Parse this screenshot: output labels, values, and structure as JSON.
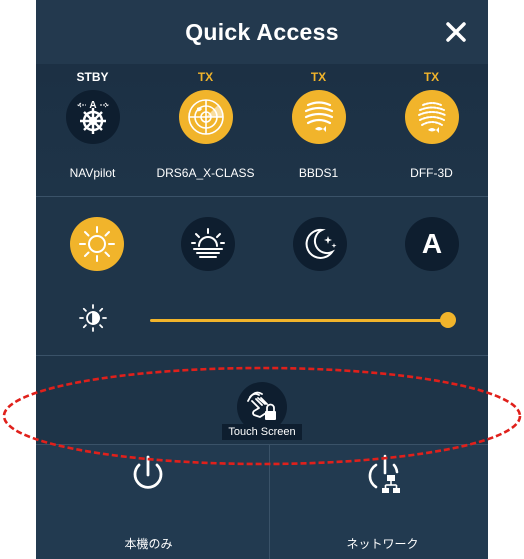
{
  "header": {
    "title": "Quick Access",
    "close_icon": "close-icon"
  },
  "devices": [
    {
      "status": "STBY",
      "name": "NAVpilot",
      "icon": "autopilot-helm-icon",
      "style": "dark"
    },
    {
      "status": "TX",
      "name": "DRS6A_X-CLASS",
      "icon": "radar-icon",
      "style": "yellow"
    },
    {
      "status": "TX",
      "name": "BBDS1",
      "icon": "sounder-fish-icon",
      "style": "yellow"
    },
    {
      "status": "TX",
      "name": "DFF-3D",
      "icon": "sounder-3d-icon",
      "style": "yellow"
    }
  ],
  "display_modes": [
    {
      "icon": "sun-day-mode-icon",
      "selected": true
    },
    {
      "icon": "sunset-dusk-mode-icon",
      "selected": false
    },
    {
      "icon": "moon-night-mode-icon",
      "selected": false
    },
    {
      "icon": "auto-mode-icon",
      "label": "A",
      "selected": false
    }
  ],
  "brightness": {
    "icon": "brightness-icon",
    "level": 1.0
  },
  "touch_screen": {
    "label": "Touch Screen",
    "icon": "touch-lock-icon"
  },
  "power": {
    "local_label": "本機のみ",
    "network_label": "ネットワーク",
    "local_icon": "power-icon",
    "network_icon": "network-power-icon"
  },
  "colors": {
    "accent": "#f1b42b",
    "panel": "#1f3549",
    "icon_bg": "#0e1e2f",
    "highlight_ellipse": "#e0201b"
  }
}
